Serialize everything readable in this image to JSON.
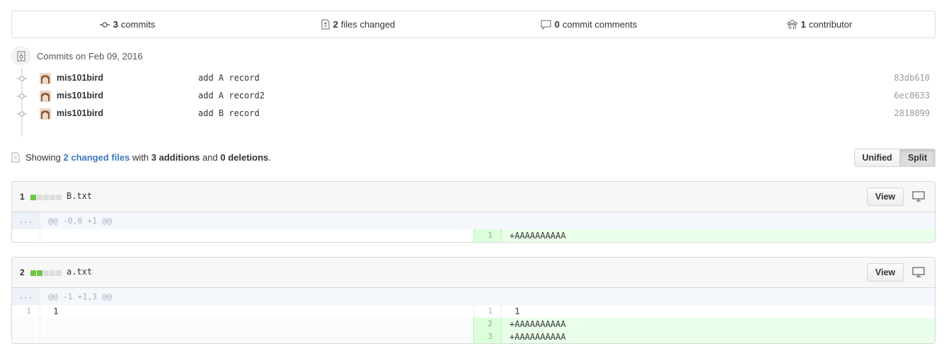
{
  "summary": {
    "commits_count": "3",
    "commits_label": "commits",
    "files_count": "2",
    "files_label": "files changed",
    "comments_count": "0",
    "comments_label": "commit comments",
    "contributors_count": "1",
    "contributors_label": "contributor"
  },
  "commits": {
    "date_label": "Commits on Feb 09, 2016",
    "items": [
      {
        "author": "mis101bird",
        "message": "add A record",
        "sha": "83db610"
      },
      {
        "author": "mis101bird",
        "message": "add A record2",
        "sha": "6ec0633"
      },
      {
        "author": "mis101bird",
        "message": "add B record",
        "sha": "2818099"
      }
    ]
  },
  "toc": {
    "showing": "Showing",
    "changed_files": "2 changed files",
    "with": "with",
    "additions": "3 additions",
    "and": "and",
    "deletions": "0 deletions",
    "period": "."
  },
  "view_toggle": {
    "unified": "Unified",
    "split": "Split",
    "selected": "Split"
  },
  "files": [
    {
      "index": "1",
      "name": "B.txt",
      "stat_blocks": [
        "add",
        "neutral",
        "neutral",
        "neutral",
        "neutral"
      ],
      "view_label": "View",
      "hunk_dots": "...",
      "hunk_header": "@@ -0,0 +1 @@",
      "lines": [
        {
          "left_num": "",
          "left_text": "",
          "right_num": "1",
          "right_text": "+AAAAAAAAAA",
          "type": "add"
        }
      ]
    },
    {
      "index": "2",
      "name": "a.txt",
      "stat_blocks": [
        "add",
        "add",
        "neutral",
        "neutral",
        "neutral"
      ],
      "view_label": "View",
      "hunk_dots": "...",
      "hunk_header": "@@ -1 +1,3 @@",
      "lines": [
        {
          "left_num": "1",
          "left_text": " 1",
          "right_num": "1",
          "right_text": " 1",
          "type": "context"
        },
        {
          "left_num": "",
          "left_text": "",
          "right_num": "2",
          "right_text": "+AAAAAAAAAA",
          "type": "add"
        },
        {
          "left_num": "",
          "left_text": "",
          "right_num": "3",
          "right_text": "+AAAAAAAAAA",
          "type": "add"
        }
      ]
    }
  ],
  "colors": {
    "link": "#4078c0",
    "addition": "#6cc644",
    "addition_bg": "#eaffea",
    "hunk_bg": "#f4f7fb"
  }
}
